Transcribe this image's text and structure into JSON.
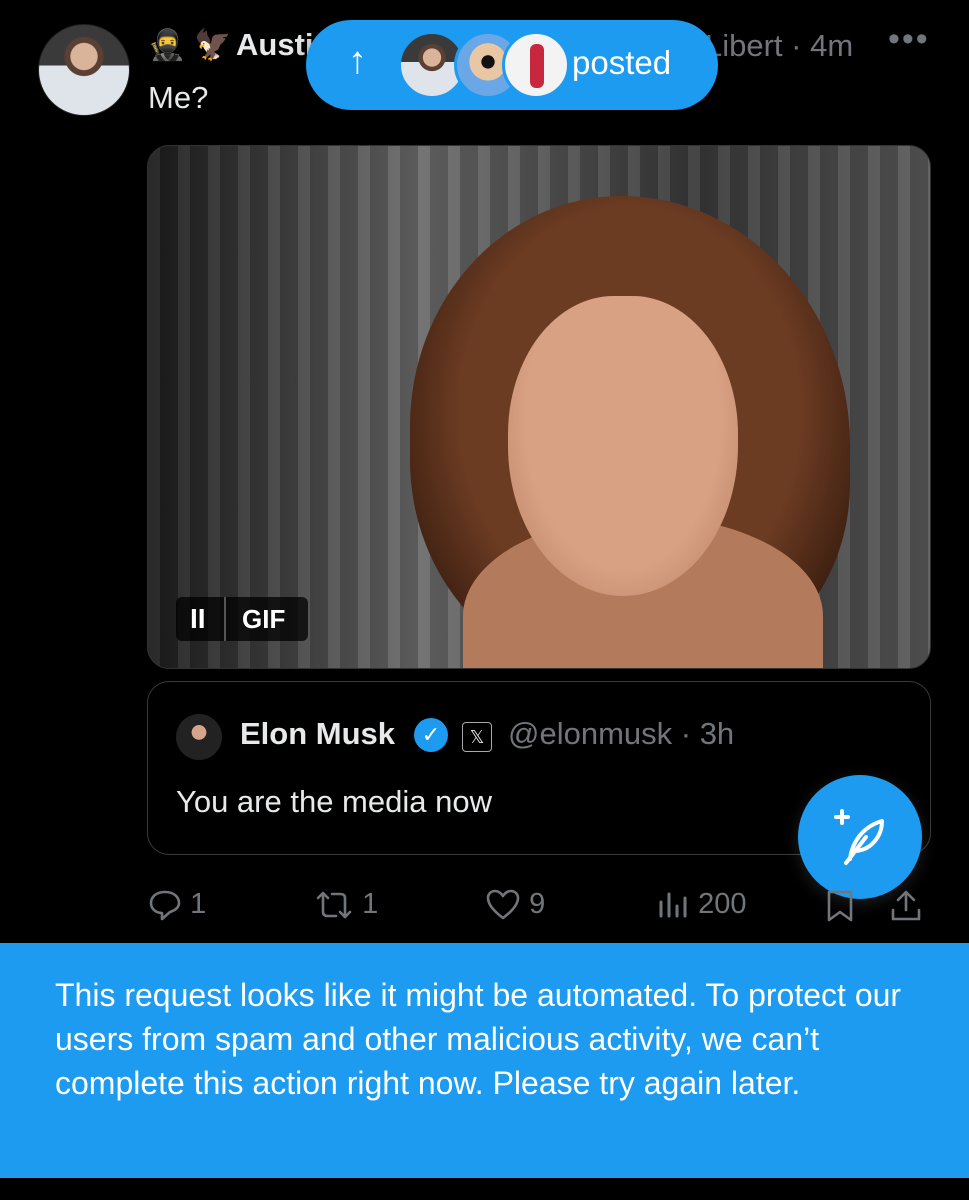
{
  "tweet": {
    "author_name": "Austi",
    "author_emojis": [
      "🥷",
      "🦅"
    ],
    "meta": "Libert · 4m",
    "more_label": "•••",
    "text": "Me?"
  },
  "new_posts_pill": {
    "arrow": "↑",
    "label": "posted"
  },
  "media": {
    "gif_pause_icon": "II",
    "gif_label": "GIF"
  },
  "quote": {
    "name": "Elon Musk",
    "verified_icon": "✓",
    "x_badge": "𝕏",
    "handle_time": "@elonmusk · 3h",
    "text": "You are the media now"
  },
  "actions": {
    "replies": "1",
    "reposts": "1",
    "likes": "9",
    "views": "200"
  },
  "toast": {
    "message": "This request looks like it might be automated. To protect our users from spam and other malicious activity, we can’t complete this action right now. Please try again later."
  },
  "colors": {
    "accent": "#1d9bf0",
    "background": "#000000",
    "muted": "#71767b",
    "text": "#e7e9ea"
  }
}
